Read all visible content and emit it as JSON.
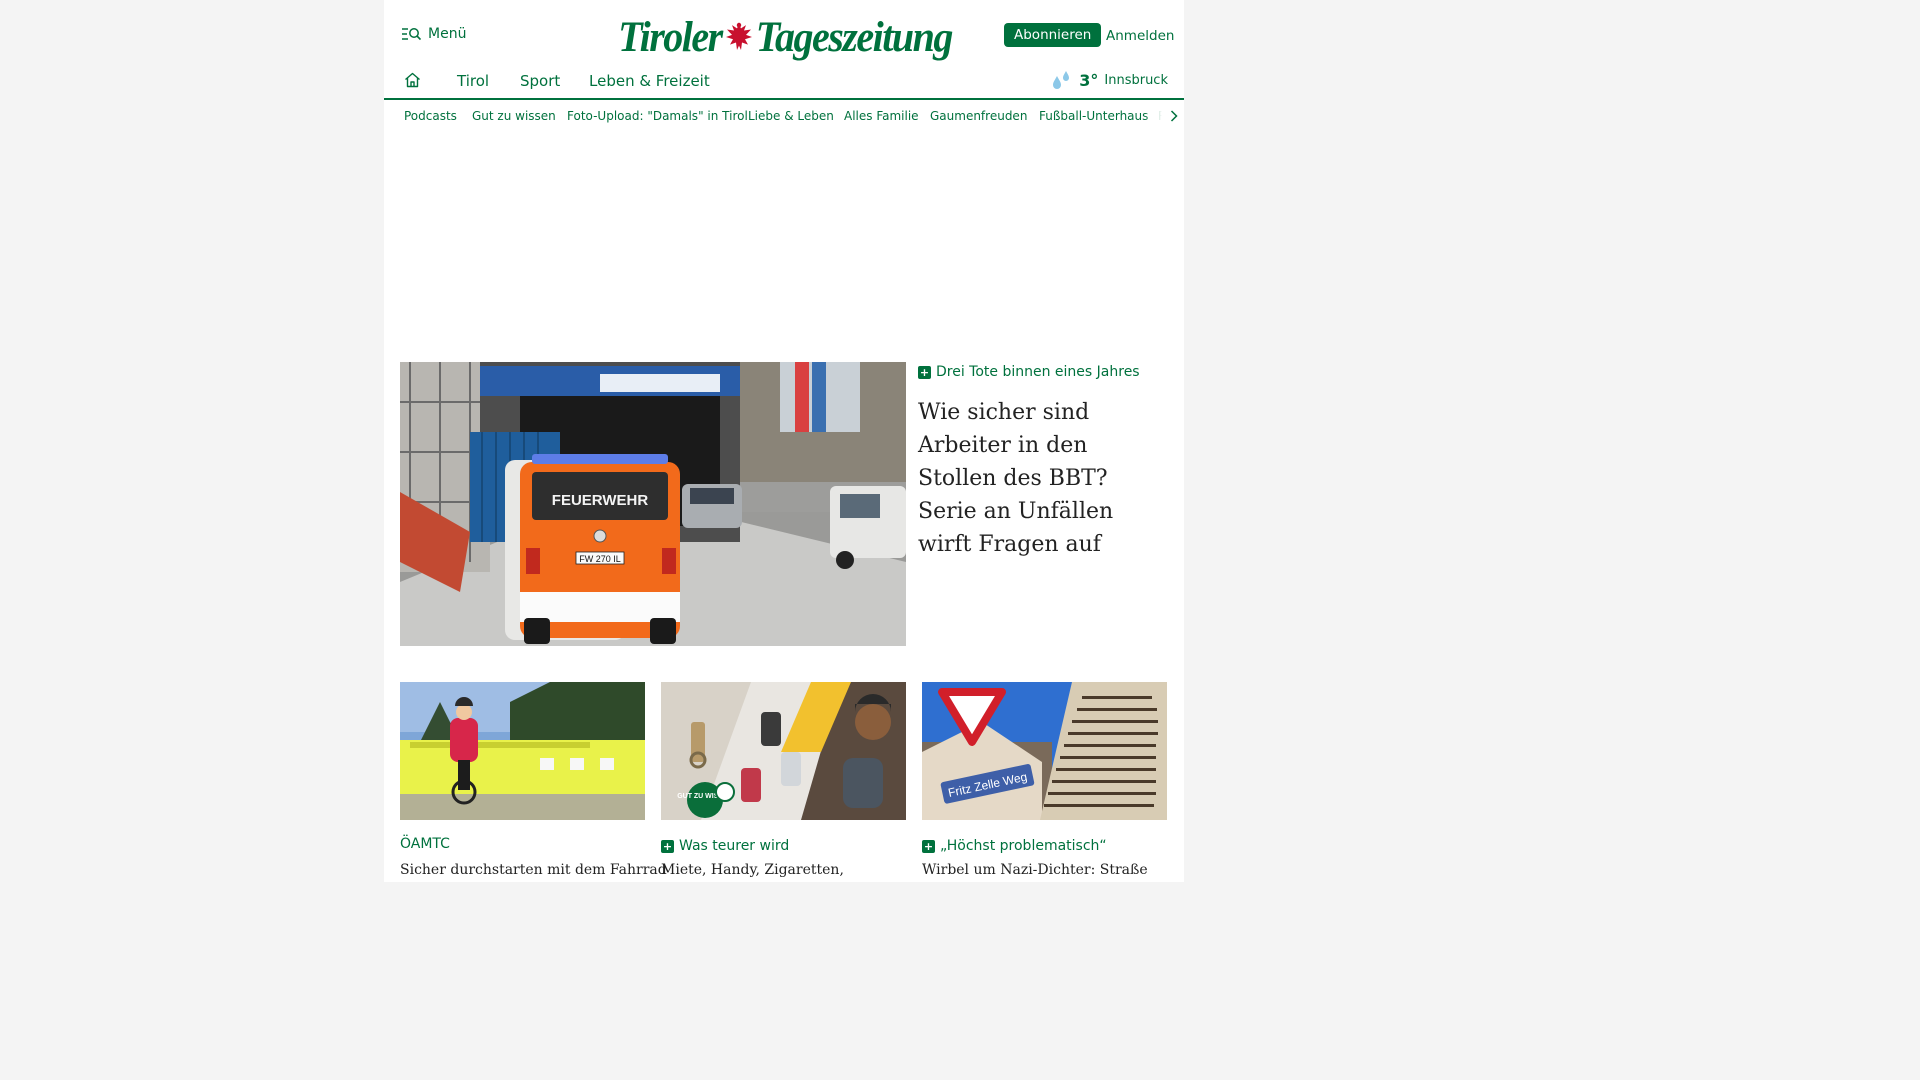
{
  "header": {
    "menu_label": "Menü",
    "logo": {
      "left": "Tiroler",
      "right": "Tageszeitung"
    },
    "subscribe_label": "Abonnieren",
    "login_label": "Anmelden"
  },
  "mainnav": {
    "items": [
      "Tirol",
      "Sport",
      "Leben & Freizeit"
    ]
  },
  "weather": {
    "temperature": "3°",
    "city": "Innsbruck",
    "icon": "rain-drops-icon"
  },
  "subnav": {
    "items": [
      "Podcasts",
      "Gut zu wissen",
      "Foto-Upload: \"Damals\" in Tirol",
      "Liebe & Leben",
      "Alles Familie",
      "Gaumenfreuden",
      "Fußball-Unterhaus",
      "R"
    ]
  },
  "hero": {
    "kicker": "Drei Tote binnen eines Jahres",
    "title": "Wie sicher sind Arbeiter in den Stollen des BBT? Serie an Unfällen wirft Fragen auf",
    "image_label": "FEUERWEHR",
    "plate": "FW 270 IL"
  },
  "tiles": [
    {
      "kicker": "ÖAMTC",
      "premium": false,
      "title": "Sicher durchstarten mit dem Fahrrad"
    },
    {
      "kicker": "Was teurer wird",
      "premium": true,
      "title": "Miete, Handy, Zigaretten,",
      "badge": "GUT ZU WISSEN"
    },
    {
      "kicker": "„Höchst problematisch“",
      "premium": true,
      "title": "Wirbel um Nazi-Dichter: Straße",
      "sign": "Fritz Zelle Weg"
    }
  ],
  "colors": {
    "brand": "#00713d"
  }
}
